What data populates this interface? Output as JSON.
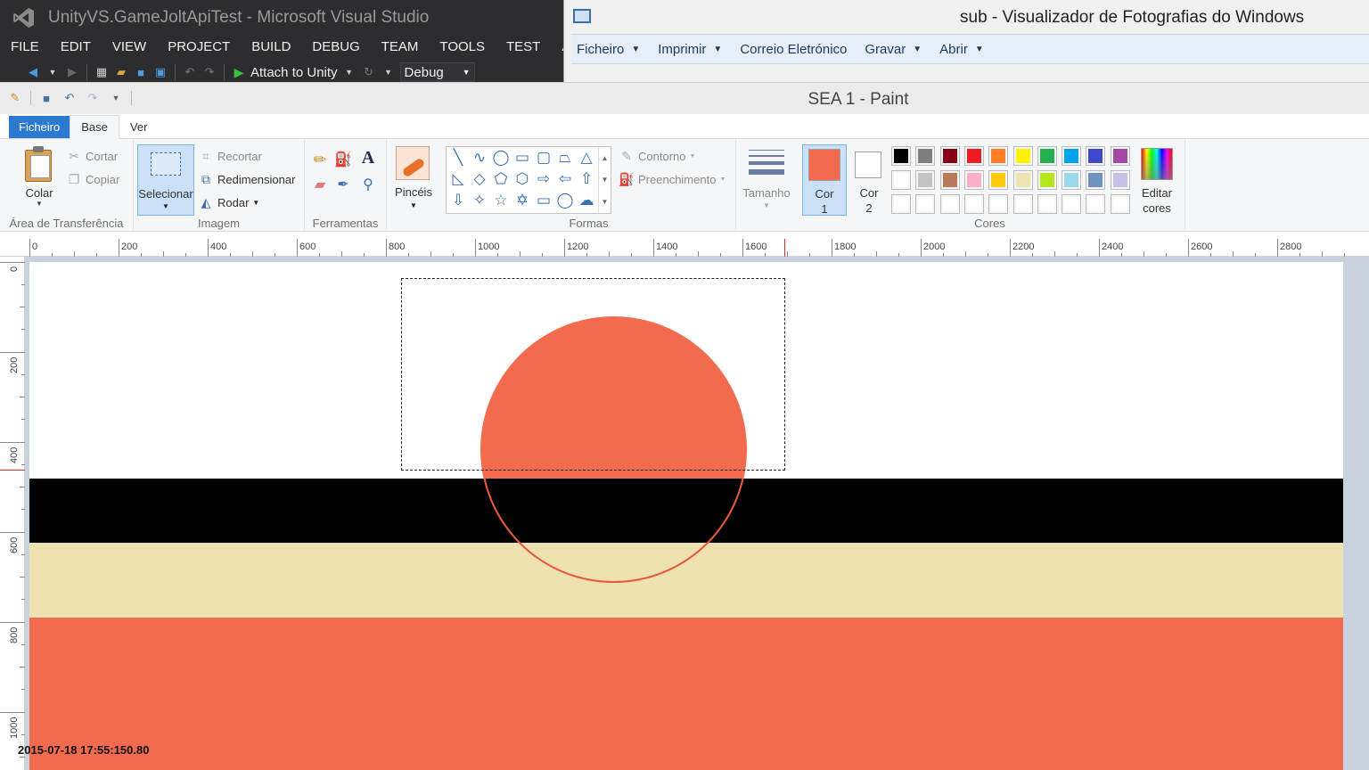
{
  "visual_studio": {
    "title": "UnityVS.GameJoltApiTest - Microsoft Visual Studio",
    "menu": [
      "FILE",
      "EDIT",
      "VIEW",
      "PROJECT",
      "BUILD",
      "DEBUG",
      "TEAM",
      "TOOLS",
      "TEST",
      "ANAL"
    ],
    "toolbar": {
      "attach_label": "Attach to Unity",
      "config": "Debug"
    }
  },
  "photo_viewer": {
    "title": "sub - Visualizador de Fotografias do Windows",
    "menu": [
      "Ficheiro",
      "Imprimir",
      "Correio Eletrónico",
      "Gravar",
      "Abrir"
    ]
  },
  "paint": {
    "title": "SEA 1 - Paint",
    "tabs": {
      "file": "Ficheiro",
      "home": "Base",
      "view": "Ver"
    },
    "clipboard": {
      "paste": "Colar",
      "cut": "Cortar",
      "copy": "Copiar",
      "group": "Área de Transferência"
    },
    "image": {
      "select": "Selecionar",
      "crop": "Recortar",
      "resize": "Redimensionar",
      "rotate": "Rodar",
      "group": "Imagem"
    },
    "tools": {
      "group": "Ferramentas"
    },
    "brushes": {
      "label": "Pincéis"
    },
    "shapes": {
      "outline": "Contorno",
      "fill": "Preenchimento",
      "group": "Formas"
    },
    "size": {
      "label": "Tamanho"
    },
    "colors": {
      "color1": "Cor",
      "color1_num": "1",
      "color2": "Cor",
      "color2_num": "2",
      "edit_label": "Editar",
      "edit_label2": "cores",
      "group": "Cores",
      "color1_value": "#f26b4f",
      "color2_value": "#ffffff",
      "palette_row1": [
        "#000000",
        "#7f7f7f",
        "#880015",
        "#ed1c24",
        "#ff7f27",
        "#fff200",
        "#22b14c",
        "#00a2e8",
        "#3f48cc",
        "#a349a4"
      ],
      "palette_row2": [
        "#ffffff",
        "#c3c3c3",
        "#b97a57",
        "#ffaec9",
        "#ffc90e",
        "#efe4b0",
        "#b5e61d",
        "#99d9ea",
        "#7092be",
        "#c8bfe7"
      ],
      "palette_row3": [
        "#ffffff",
        "#ffffff",
        "#ffffff",
        "#ffffff",
        "#ffffff",
        "#ffffff",
        "#ffffff",
        "#ffffff",
        "#ffffff",
        "#ffffff"
      ]
    },
    "hruler_labels": [
      "0",
      "200",
      "400",
      "600",
      "800",
      "1000",
      "1200",
      "1400",
      "1600",
      "1800",
      "2000",
      "2200",
      "2400",
      "2600",
      "2800"
    ],
    "vruler_labels": [
      "0",
      "200",
      "400",
      "600",
      "800",
      "1000"
    ],
    "canvas": {
      "band_colors": [
        "#ffffff",
        "#000000",
        "#eee3b0",
        "#f26b4f"
      ],
      "circle_color": "#f26b4f",
      "circle_outline": "#e8583d"
    }
  },
  "overlay": {
    "timestamp": "2015-07-18 17:55:150.80"
  }
}
